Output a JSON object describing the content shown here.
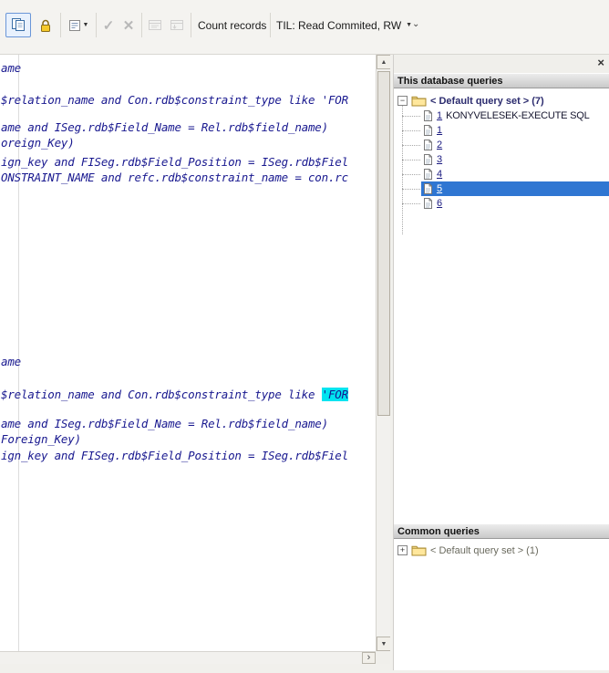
{
  "toolbar": {
    "count_records": "Count records",
    "til": "TIL: Read Commited, RW"
  },
  "editor": {
    "lines": [
      {
        "text": "ame"
      },
      {
        "text": "$relation_name and Con.rdb$constraint_type like 'FOR"
      },
      {
        "text": "ame and ISeg.rdb$Field_Name = Rel.rdb$field_name)"
      },
      {
        "text": "oreign_Key)"
      },
      {
        "text": "ign_key and FISeg.rdb$Field_Position = ISeg.rdb$Fiel"
      },
      {
        "text": "ONSTRAINT_NAME and refc.rdb$constraint_name = con.rc"
      },
      {
        "text": "ame"
      },
      {
        "pre": "$relation_name and Con.rdb$constraint_type like ",
        "hl": "'FOR"
      },
      {
        "text": "ame and ISeg.rdb$Field_Name = Rel.rdb$field_name)"
      },
      {
        "text": "Foreign_Key)"
      },
      {
        "text": "ign_key and FISeg.rdb$Field_Position = ISeg.rdb$Fiel"
      }
    ]
  },
  "this_db": {
    "header": "This database queries",
    "root": "< Default query set > (7)",
    "items": [
      {
        "num": "1",
        "label": "KONYVELESEK-EXECUTE SQL"
      },
      {
        "num": "1",
        "label": ""
      },
      {
        "num": "2",
        "label": ""
      },
      {
        "num": "3",
        "label": ""
      },
      {
        "num": "4",
        "label": ""
      },
      {
        "num": "5",
        "label": ""
      },
      {
        "num": "6",
        "label": ""
      }
    ],
    "selected_index": 5
  },
  "common": {
    "header": "Common queries",
    "root": "< Default query set > (1)"
  },
  "icons": {
    "close": "×",
    "check": "✓",
    "cross": "✕",
    "dropdown": "▼",
    "chevron": "⌄",
    "up_arrow": "▲",
    "down_arrow": "▼",
    "right_arrow": "›",
    "minus": "−",
    "plus": "+"
  },
  "colors": {
    "selection": "#2f76d2",
    "match_highlight": "#00e4f0",
    "editor_text": "#18188f"
  }
}
